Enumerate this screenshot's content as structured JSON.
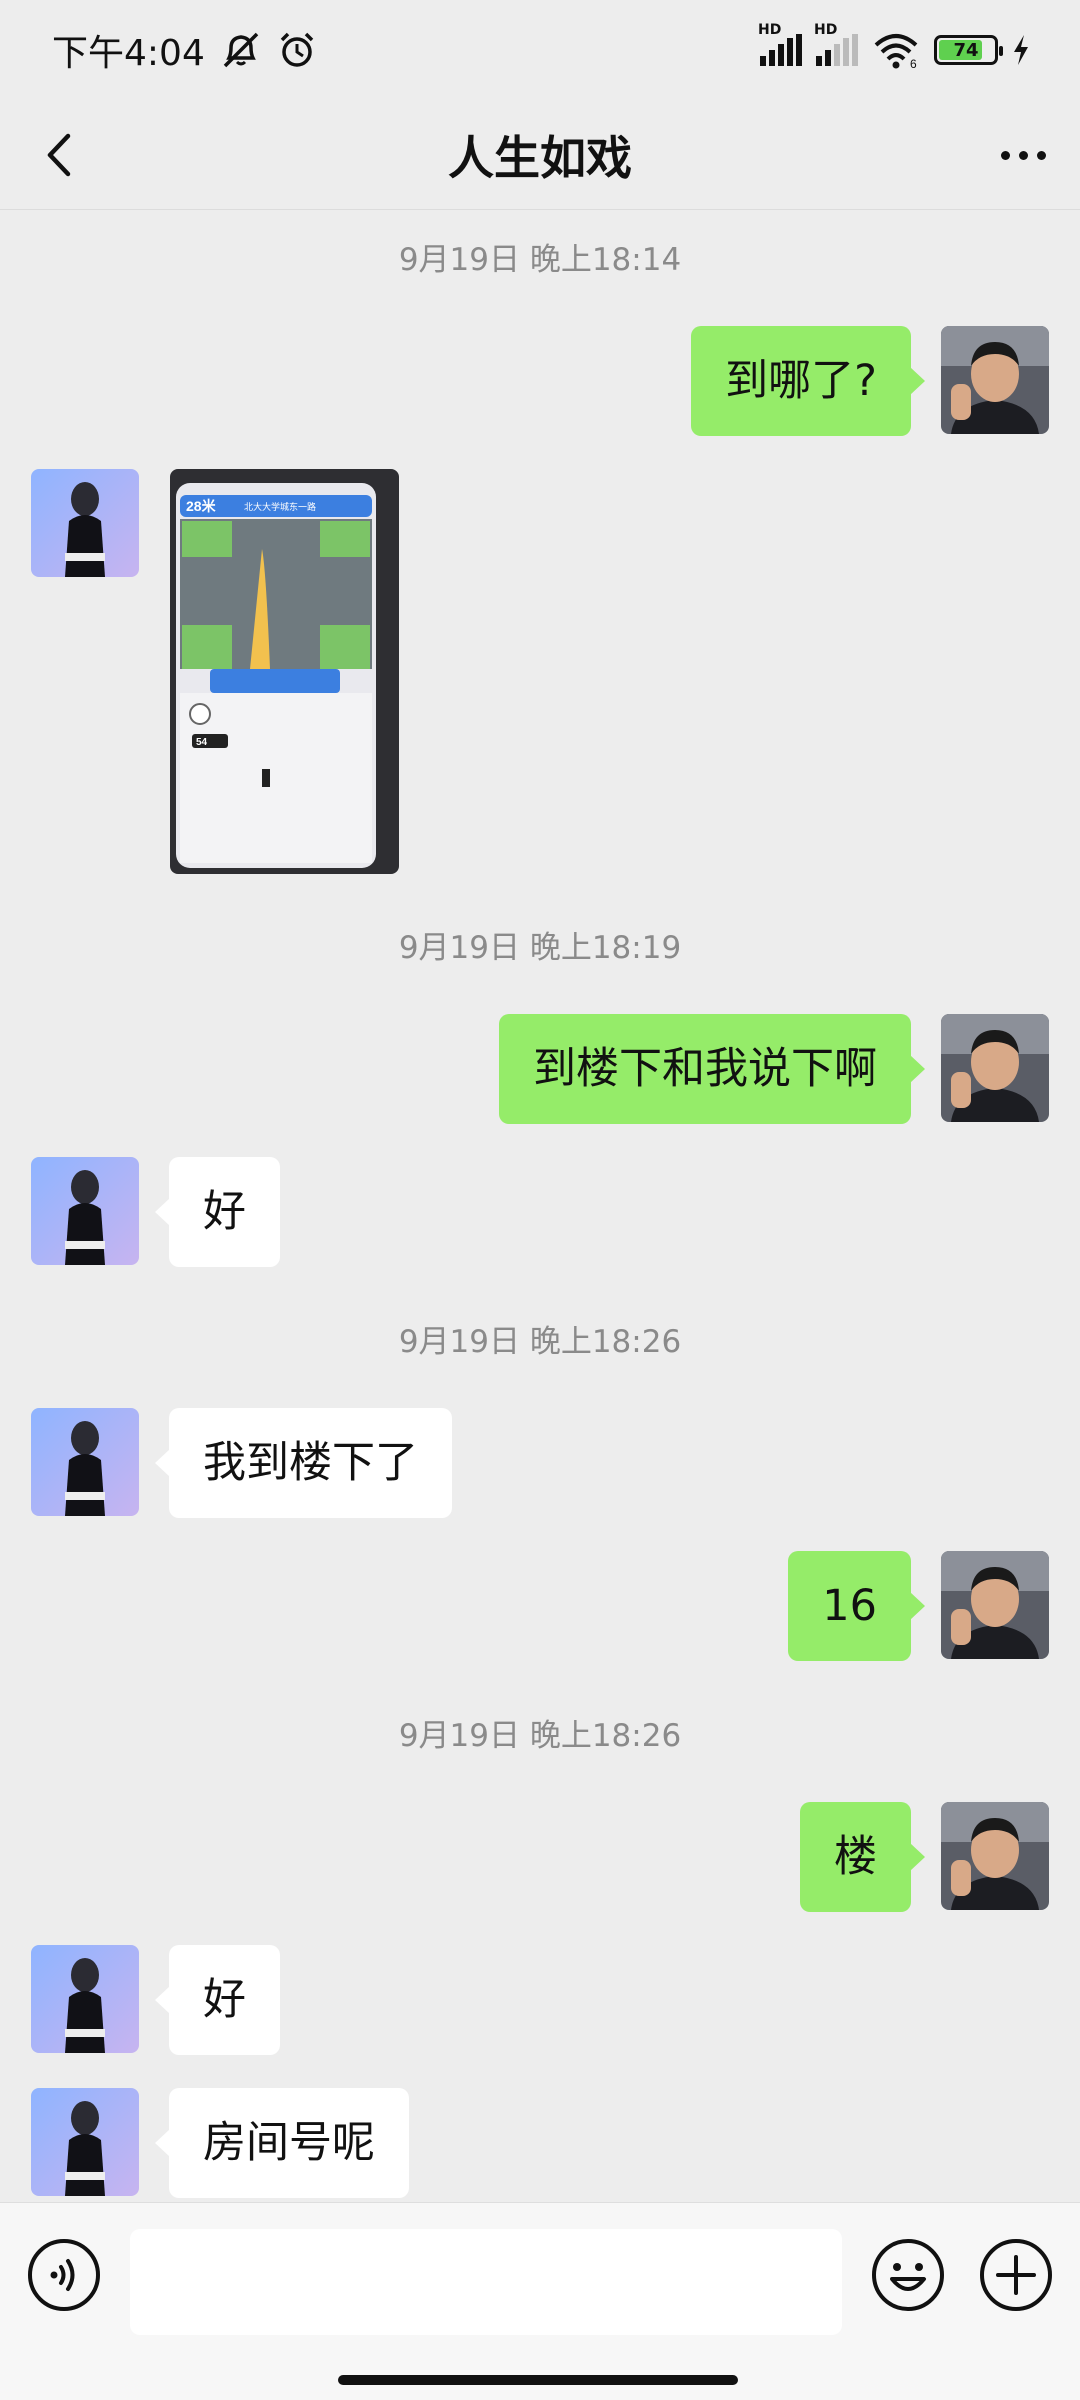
{
  "status_bar": {
    "time": "下午4:04",
    "network_badge_1": "HD",
    "network_badge_2": "HD",
    "wifi_badge": "6",
    "battery_level": "74"
  },
  "nav": {
    "title": "人生如戏"
  },
  "messages": [
    {
      "kind": "timestamp",
      "text": "9月19日 晚上18:14"
    },
    {
      "kind": "outgoing",
      "text": "到哪了?"
    },
    {
      "kind": "incoming-image",
      "image_texts": [
        "28米",
        "北大大学城东一路",
        "54"
      ]
    },
    {
      "kind": "timestamp",
      "text": "9月19日 晚上18:19"
    },
    {
      "kind": "outgoing",
      "text": "到楼下和我说下啊"
    },
    {
      "kind": "incoming",
      "text": "好"
    },
    {
      "kind": "timestamp",
      "text": "9月19日 晚上18:26"
    },
    {
      "kind": "incoming",
      "text": "我到楼下了"
    },
    {
      "kind": "outgoing",
      "text": "16"
    },
    {
      "kind": "timestamp",
      "text": "9月19日 晚上18:26"
    },
    {
      "kind": "outgoing",
      "text": "楼"
    },
    {
      "kind": "incoming",
      "text": "好"
    },
    {
      "kind": "incoming",
      "text": "房间号呢"
    }
  ],
  "input_bar": {
    "text_value": "",
    "placeholder": ""
  },
  "colors": {
    "outgoing_bubble": "#95ec69",
    "incoming_bubble": "#ffffff",
    "chat_background": "#ededed",
    "timestamp_text": "#8a8a8a"
  },
  "icons": [
    "back-icon",
    "more-icon",
    "voice-icon",
    "emoji-icon",
    "plus-icon",
    "mute-icon",
    "alarm-icon",
    "wifi-icon",
    "charging-icon"
  ]
}
